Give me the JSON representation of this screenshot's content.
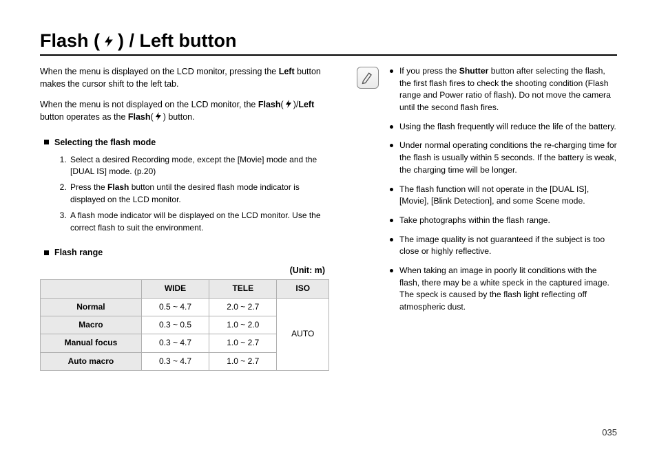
{
  "title": {
    "part1": "Flash (",
    "part2": ") / Left button"
  },
  "intro": {
    "p1a": "When the menu is displayed on the LCD monitor, pressing the ",
    "p1b": "Left",
    "p1c": " button makes the cursor shift to the left tab.",
    "p2a": "When the menu is not displayed on the LCD monitor, the ",
    "p2b": "Flash",
    "p2c": "(",
    "p2d": ")/",
    "p2e": "Left",
    "p2f": " button operates as the ",
    "p2g": "Flash",
    "p2h": "(",
    "p2i": ") button."
  },
  "sectionA": {
    "heading": "Selecting the flash mode",
    "steps": [
      "Select a desired Recording mode, except the [Movie] mode and the [DUAL IS] mode. (p.20)",
      "Press the Flash button until the desired flash mode indicator is displayed on the LCD monitor.",
      "A flash mode indicator will be displayed on the LCD monitor. Use the correct flash to suit the environment."
    ],
    "step2_pre": "Press the ",
    "step2_bold": "Flash",
    "step2_post": " button until the desired flash mode indicator is displayed on the LCD monitor."
  },
  "sectionB": {
    "heading": "Flash range",
    "unit": "(Unit: m)"
  },
  "table": {
    "headers": {
      "wide": "WIDE",
      "tele": "TELE",
      "iso": "ISO"
    },
    "rows": [
      {
        "label": "Normal",
        "wide": "0.5 ~ 4.7",
        "tele": "2.0 ~ 2.7"
      },
      {
        "label": "Macro",
        "wide": "0.3 ~ 0.5",
        "tele": "1.0 ~ 2.0"
      },
      {
        "label": "Manual focus",
        "wide": "0.3 ~ 4.7",
        "tele": "1.0 ~ 2.7"
      },
      {
        "label": "Auto macro",
        "wide": "0.3 ~ 4.7",
        "tele": "1.0 ~ 2.7"
      }
    ],
    "iso_value": "AUTO"
  },
  "notes": {
    "n1a": "If you press the ",
    "n1b": "Shutter",
    "n1c": " button after selecting the flash, the first flash fires to check the shooting condition (Flash range and Power ratio of flash). Do not move the camera until the second flash fires.",
    "rest": [
      "Using the flash frequently will reduce the life of the battery.",
      "Under normal operating conditions the re-charging time for the flash is usually within 5 seconds. If the battery is weak, the charging time will be longer.",
      "The flash function will not operate in the [DUAL IS], [Movie], [Blink Detection], and some Scene mode.",
      "Take photographs within the flash range.",
      "The image quality is not guaranteed if the subject is too close or highly reflective.",
      "When taking an image in poorly lit conditions with the flash, there may be a white speck in the captured image. The speck is caused by the flash light reflecting off atmospheric dust."
    ]
  },
  "page_number": "035"
}
